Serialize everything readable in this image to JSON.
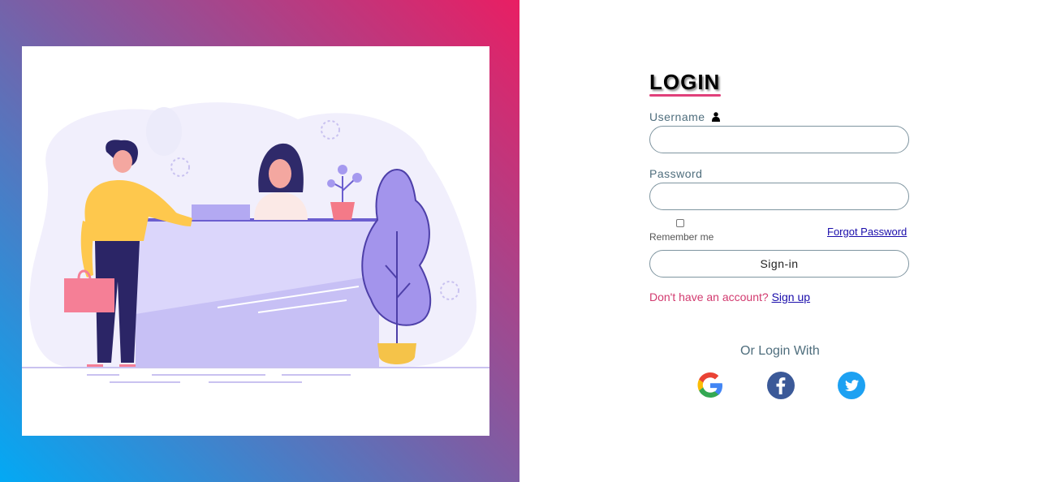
{
  "login": {
    "title": "LOGIN",
    "username_label": "Username",
    "password_label": "Password",
    "username_value": "",
    "password_value": "",
    "remember_label": "Remember me",
    "forgot_label": "Forgot Password",
    "signin_label": "Sign-in",
    "no_account_text": "Don't have an account?",
    "signup_label": "Sign up",
    "or_login_with": "Or Login With"
  },
  "social": [
    "google-icon",
    "facebook-icon",
    "twitter-icon"
  ],
  "colors": {
    "gradient_start": "#03a9f4",
    "gradient_end": "#e91e63",
    "accent_pink": "#e0407a",
    "label_slate": "#4f6e7d",
    "link_blue": "#1a0dab",
    "facebook_blue": "#3b5998",
    "twitter_blue": "#1da1f2"
  }
}
